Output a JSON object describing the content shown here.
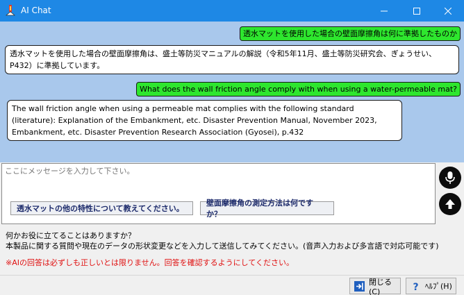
{
  "window": {
    "title": "AI Chat"
  },
  "chat": {
    "messages": [
      {
        "role": "user",
        "text": "透水マットを使用した場合の壁面摩擦角は何に準拠したものか"
      },
      {
        "role": "ai",
        "text": "透水マットを使用した場合の壁面摩擦角は、盛土等防災マニュアルの解説（令和5年11月、盛土等防災研究会、ぎょうせい、P432）に準拠しています。"
      },
      {
        "role": "user",
        "text": "What does the wall friction angle comply with when using a water-permeable mat?"
      },
      {
        "role": "ai",
        "text": "The wall friction angle when using a permeable mat complies with the following standard (literature): Explanation of the Embankment, etc. Disaster Prevention Manual, November 2023, Embankment, etc. Disaster Prevention Research Association (Gyosei), p.432"
      }
    ]
  },
  "input": {
    "placeholder": "ここにメッセージを入力して下さい。",
    "value": ""
  },
  "suggestions": [
    "透水マットの他の特性について教えてください。",
    "壁面摩擦角の測定方法は何ですか？"
  ],
  "info": {
    "line1": "何かお役に立てることはありますか？",
    "line2": "本製品に関する質問や現在のデータの形状変更などを入力して送信してみてください。(音声入力および多言語で対応可能です)",
    "warning": "※AIの回答は必ずしも正しいとは限りません。回答を確認するようにしてください。"
  },
  "footer": {
    "close_label": "閉じる(C)",
    "help_label": "ﾍﾙﾌﾟ(H)"
  },
  "icons": {
    "app": "app-icon",
    "minimize": "minimize-icon",
    "maximize": "maximize-icon",
    "close": "close-icon",
    "mic": "microphone-icon",
    "send": "arrow-up-icon",
    "exit": "exit-icon",
    "help": "question-icon"
  },
  "colors": {
    "titlebar": "#1e88e5",
    "chat_bg": "#a9c8ec",
    "user_bubble": "#2ee62e",
    "ai_bubble": "#ffffff",
    "suggestion_text": "#1c2a6b",
    "warning": "#e01010"
  }
}
